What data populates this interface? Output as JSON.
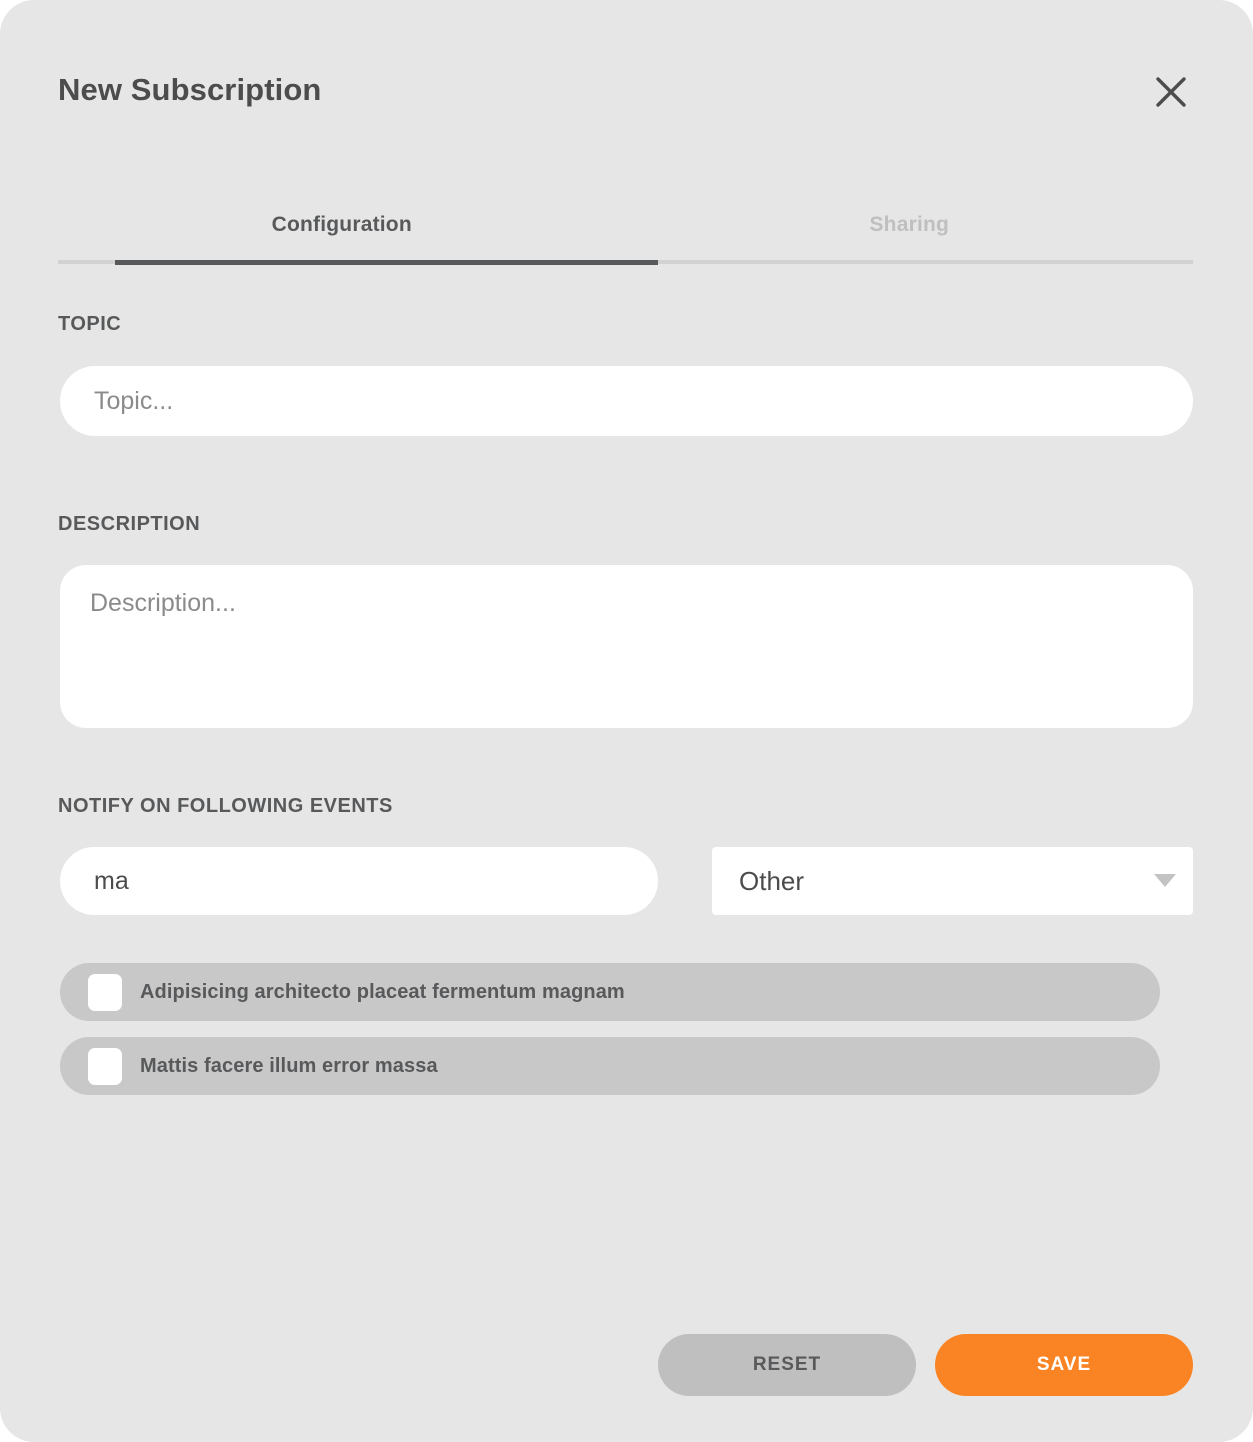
{
  "dialog": {
    "title": "New Subscription",
    "close_icon": "close-x-icon"
  },
  "tabs": [
    {
      "label": "Configuration",
      "state": "active"
    },
    {
      "label": "Sharing",
      "state": "disabled"
    }
  ],
  "fields": {
    "topic": {
      "label": "TOPIC",
      "placeholder": "Topic...",
      "value": ""
    },
    "description": {
      "label": "DESCRIPTION",
      "placeholder": "Description...",
      "value": ""
    },
    "events": {
      "label": "NOTIFY ON FOLLOWING EVENTS",
      "search": {
        "placeholder": "",
        "value": "ma"
      },
      "category_select": {
        "value": "Other",
        "caret_icon": "chevron-down-icon"
      },
      "results": [
        {
          "label": "Adipisicing architecto placeat fermentum magnam",
          "checked": false
        },
        {
          "label": "Mattis facere illum error massa",
          "checked": false
        }
      ]
    }
  },
  "footer": {
    "reset_label": "RESET",
    "save_label": "SAVE"
  },
  "colors": {
    "dialog_background": "#e6e6e6",
    "accent_orange": "#fa8423",
    "text_dark": "#58595b",
    "row_background": "#c8c8c8",
    "tab_track": "#d2d2d2",
    "placeholder": "#8b8b8b"
  }
}
